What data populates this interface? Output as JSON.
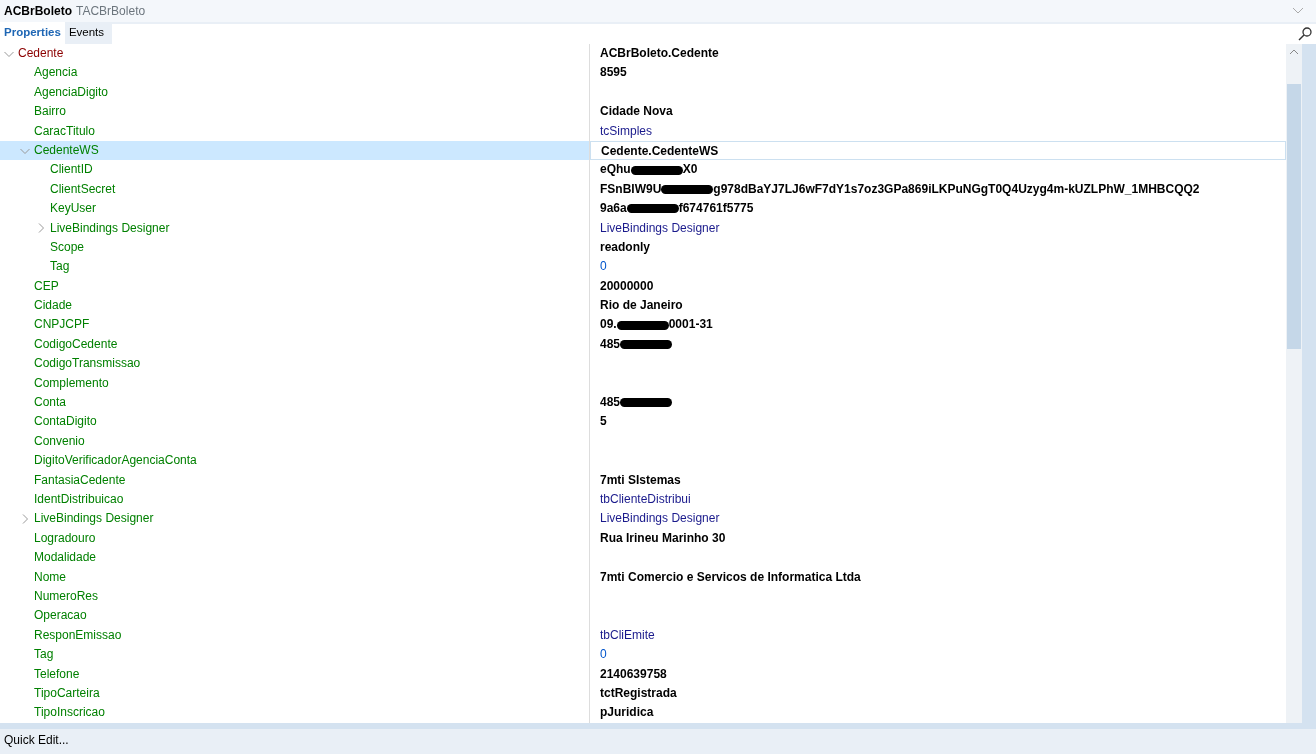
{
  "header": {
    "component": "ACBrBoleto",
    "class": "TACBrBoleto"
  },
  "tabs": [
    {
      "label": "Properties",
      "selected": true
    },
    {
      "label": "Events",
      "selected": false
    }
  ],
  "properties": [
    {
      "name": "Cedente",
      "category": true,
      "expanded": true,
      "selected": false,
      "value": "ACBrBoleto.Cedente",
      "kind": "modified",
      "children": [
        {
          "name": "Agencia",
          "selected": false,
          "value": "8595",
          "kind": "modified"
        },
        {
          "name": "AgenciaDigito",
          "selected": false
        },
        {
          "name": "Bairro",
          "selected": false,
          "value": "Cidade Nova",
          "kind": "modified"
        },
        {
          "name": "CaracTitulo",
          "selected": false,
          "value": "tcSimples",
          "kind": "default"
        },
        {
          "name": "CedenteWS",
          "expanded": true,
          "selected": true,
          "value": "Cedente.CedenteWS",
          "kind": "modified",
          "children": [
            {
              "name": "ClientID",
              "selected": false,
              "value": "eQhu",
              "redacted": true,
              "value_end": "X0",
              "kind": "modified"
            },
            {
              "name": "ClientSecret",
              "selected": false,
              "value": "FSnBIW9U",
              "redacted": true,
              "value_end": "g978dBaYJ7LJ6wF7dY1s7oz3GPa869iLKPuNGgT0Q4Uzyg4m-kUZLPhW_1MHBCQQ2",
              "kind": "modified"
            },
            {
              "name": "KeyUser",
              "selected": false,
              "value": "9a6a",
              "redacted": true,
              "value_end": "f674761f5775",
              "kind": "modified"
            },
            {
              "name": "LiveBindings Designer",
              "expanded": false,
              "selected": false,
              "value": "LiveBindings Designer",
              "kind": "default"
            },
            {
              "name": "Scope",
              "selected": false,
              "value": "readonly",
              "kind": "modified"
            },
            {
              "name": "Tag",
              "selected": false,
              "value": "0",
              "kind": "number"
            }
          ]
        },
        {
          "name": "CEP",
          "selected": false,
          "value": "20000000",
          "kind": "modified"
        },
        {
          "name": "Cidade",
          "selected": false,
          "value": "Rio de Janeiro",
          "kind": "modified"
        },
        {
          "name": "CNPJCPF",
          "selected": false,
          "value": "09.",
          "redacted": true,
          "value_end": "0001-31",
          "kind": "modified"
        },
        {
          "name": "CodigoCedente",
          "selected": false,
          "value": "485",
          "redacted": true,
          "kind": "modified"
        },
        {
          "name": "CodigoTransmissao",
          "selected": false
        },
        {
          "name": "Complemento",
          "selected": false
        },
        {
          "name": "Conta",
          "selected": false,
          "value": "485",
          "redacted": true,
          "kind": "modified"
        },
        {
          "name": "ContaDigito",
          "selected": false,
          "value": "5",
          "kind": "modified"
        },
        {
          "name": "Convenio",
          "selected": false
        },
        {
          "name": "DigitoVerificadorAgenciaConta",
          "selected": false
        },
        {
          "name": "FantasiaCedente",
          "selected": false,
          "value": "7mti SIstemas",
          "kind": "modified"
        },
        {
          "name": "IdentDistribuicao",
          "selected": false,
          "value": "tbClienteDistribui",
          "kind": "default"
        },
        {
          "name": "LiveBindings Designer",
          "expanded": false,
          "selected": false,
          "value": "LiveBindings Designer",
          "kind": "default"
        },
        {
          "name": "Logradouro",
          "selected": false,
          "value": "Rua Irineu Marinho 30",
          "kind": "modified"
        },
        {
          "name": "Modalidade",
          "selected": false
        },
        {
          "name": "Nome",
          "selected": false,
          "value": "7mti Comercio e Servicos de Informatica Ltda",
          "kind": "modified"
        },
        {
          "name": "NumeroRes",
          "selected": false
        },
        {
          "name": "Operacao",
          "selected": false
        },
        {
          "name": "ResponEmissao",
          "selected": false,
          "value": "tbCliEmite",
          "kind": "default"
        },
        {
          "name": "Tag",
          "selected": false,
          "value": "0",
          "kind": "number"
        },
        {
          "name": "Telefone",
          "selected": false,
          "value": "2140639758",
          "kind": "modified"
        },
        {
          "name": "TipoCarteira",
          "selected": false,
          "value": "tctRegistrada",
          "kind": "modified"
        },
        {
          "name": "TipoInscricao",
          "selected": false,
          "value": "pJuridica",
          "kind": "modified"
        }
      ]
    }
  ],
  "footer": {
    "label": "Quick Edit..."
  }
}
